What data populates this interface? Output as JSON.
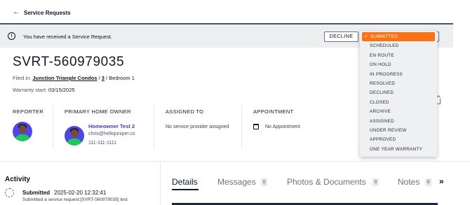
{
  "nav": {
    "back_label": "Service Requests"
  },
  "notice": {
    "message": "You have received a Service Request.",
    "decline_label": "DECLINE"
  },
  "status_dropdown": {
    "selected": "SUBMITTED",
    "options": [
      "SUBMITTED",
      "SCHEDULED",
      "EN ROUTE",
      "ON HOLD",
      "IN PROGRESS",
      "RESOLVED",
      "DECLINED",
      "CLOSED",
      "ARCHIVE",
      "ASSIGNED",
      "UNDER REVIEW",
      "APPROVED",
      "ONE YEAR WARRANTY"
    ],
    "accent_color": "#f97316"
  },
  "request": {
    "id": "SVRT-560979035",
    "filed_in_label": "Filed in:",
    "community": "Junction Triangle Condos",
    "unit": "3",
    "room": "Bedroom 1",
    "warranty_label": "Warranty start:",
    "warranty_start": "03/15/2025"
  },
  "sections": {
    "reporter": {
      "label": "REPORTER"
    },
    "owner": {
      "label": "PRIMARY HOME OWNER",
      "name": "Homeowner Test 2",
      "email": "chris@hellojuniper.co",
      "phone": "111-111-1111"
    },
    "assigned": {
      "label": "ASSIGNED TO",
      "value": "No service provider assigned"
    },
    "appointment": {
      "label": "APPOINTMENT",
      "value": "No Appointment"
    }
  },
  "activity": {
    "title": "Activity",
    "items": [
      {
        "status": "Submitted",
        "time": "2025-02-20 12:32:41",
        "desc": "Submitted a service request:[SVRT-560979035] test"
      }
    ]
  },
  "tabs": [
    {
      "label": "Details"
    },
    {
      "label": "Messages",
      "count": "0"
    },
    {
      "label": "Photos & Documents",
      "count": "0"
    },
    {
      "label": "Notes",
      "count": "0"
    }
  ],
  "tab_more": "»"
}
